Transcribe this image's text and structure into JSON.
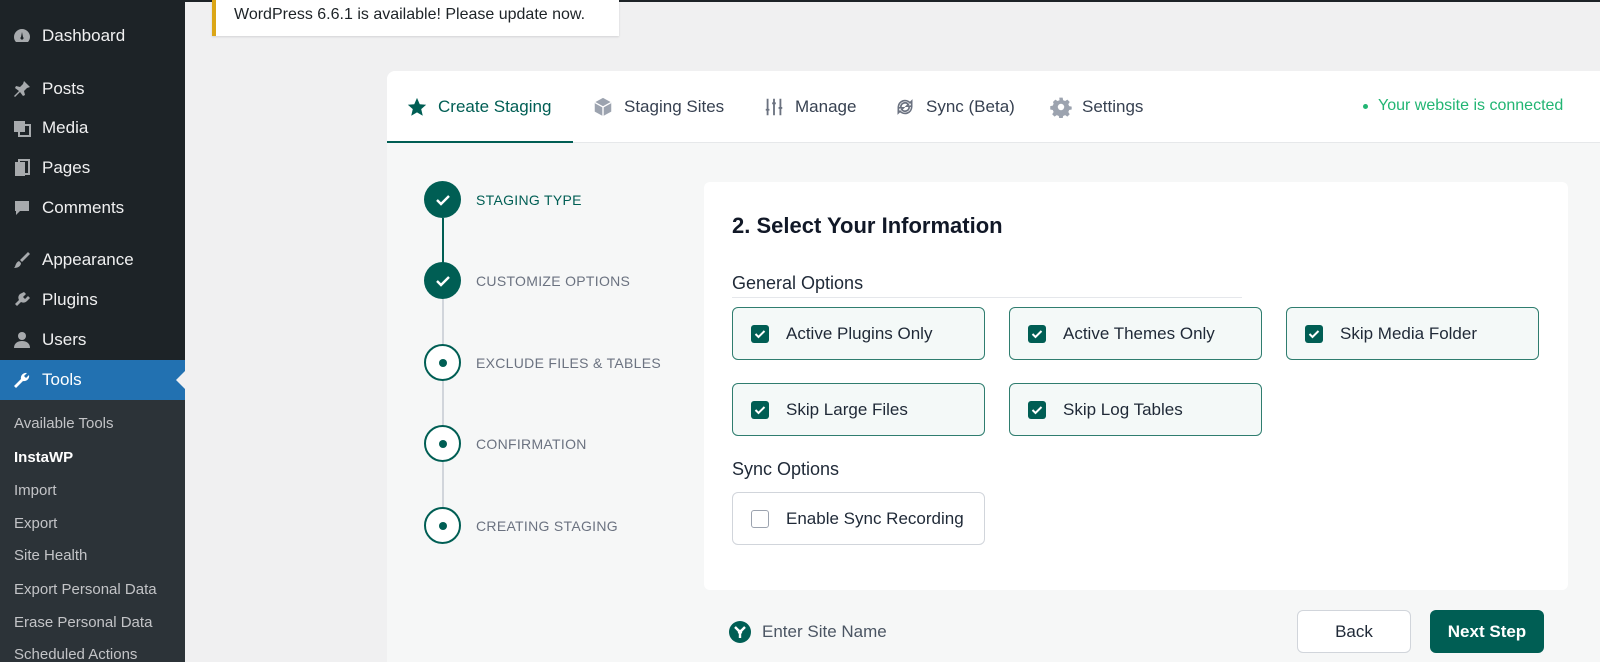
{
  "sidebar": {
    "items": [
      {
        "label": "Dashboard",
        "icon": "dashboard-icon"
      },
      {
        "label": "Posts",
        "icon": "pin-icon"
      },
      {
        "label": "Media",
        "icon": "media-icon"
      },
      {
        "label": "Pages",
        "icon": "pages-icon"
      },
      {
        "label": "Comments",
        "icon": "comment-icon"
      },
      {
        "label": "Appearance",
        "icon": "brush-icon"
      },
      {
        "label": "Plugins",
        "icon": "plugin-icon"
      },
      {
        "label": "Users",
        "icon": "user-icon"
      },
      {
        "label": "Tools",
        "icon": "wrench-icon",
        "active": true
      }
    ],
    "submenu": [
      "Available Tools",
      "InstaWP",
      "Import",
      "Export",
      "Site Health",
      "Export Personal Data",
      "Erase Personal Data",
      "Scheduled Actions"
    ],
    "current_submenu": "InstaWP"
  },
  "notice": {
    "text": "WordPress 6.6.1 is available! Please update now."
  },
  "tabs": [
    {
      "label": "Create Staging",
      "icon": "star-icon",
      "active": true
    },
    {
      "label": "Staging Sites",
      "icon": "cube-icon"
    },
    {
      "label": "Manage",
      "icon": "sliders-icon"
    },
    {
      "label": "Sync (Beta)",
      "icon": "sync-icon"
    },
    {
      "label": "Settings",
      "icon": "gear-icon"
    }
  ],
  "status": {
    "connected_text": "Your website is connected",
    "color": "#22b573"
  },
  "steps": [
    {
      "label": "STAGING TYPE",
      "state": "done"
    },
    {
      "label": "CUSTOMIZE OPTIONS",
      "state": "done"
    },
    {
      "label": "EXCLUDE FILES & TABLES",
      "state": "pending"
    },
    {
      "label": "CONFIRMATION",
      "state": "pending"
    },
    {
      "label": "CREATING STAGING",
      "state": "pending"
    }
  ],
  "card": {
    "title": "2. Select Your Information",
    "general_title": "General Options",
    "general_options": [
      {
        "label": "Active Plugins Only",
        "checked": true
      },
      {
        "label": "Active Themes Only",
        "checked": true
      },
      {
        "label": "Skip Media Folder",
        "checked": true
      },
      {
        "label": "Skip Large Files",
        "checked": true
      },
      {
        "label": "Skip Log Tables",
        "checked": true
      }
    ],
    "sync_title": "Sync Options",
    "sync_options": [
      {
        "label": "Enable Sync Recording",
        "checked": false
      }
    ]
  },
  "footer": {
    "site_name_placeholder": "Enter Site Name",
    "back_label": "Back",
    "next_label": "Next Step"
  },
  "colors": {
    "brand": "#005e54",
    "wp_sidebar": "#1d2327",
    "wp_active": "#2271b1"
  }
}
